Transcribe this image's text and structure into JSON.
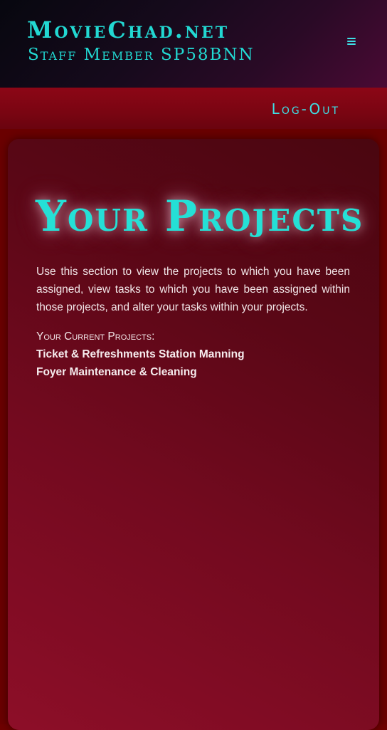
{
  "header": {
    "site_title": "MovieChad.net",
    "staff_line": "Staff Member SP58BNN",
    "menu_icon": "hamburger-menu-icon"
  },
  "nav": {
    "logout_label": "Log-Out"
  },
  "main": {
    "title": "Your Projects",
    "intro": "Use this section to view the projects to which you have been assigned, view tasks to which you have been assigned within those projects, and alter your tasks within your projects.",
    "current_projects_heading": "Your Current Projects:",
    "projects": [
      "Ticket & Refreshments Station Manning",
      "Foyer Maintenance & Cleaning"
    ]
  },
  "colors": {
    "accent": "#22d8d2",
    "header_bg": "#0a0a12",
    "navbar_bg": "#7a0512",
    "page_bg": "#6a0000",
    "card_bg": "#730a1f",
    "text": "#f2e6e8"
  }
}
